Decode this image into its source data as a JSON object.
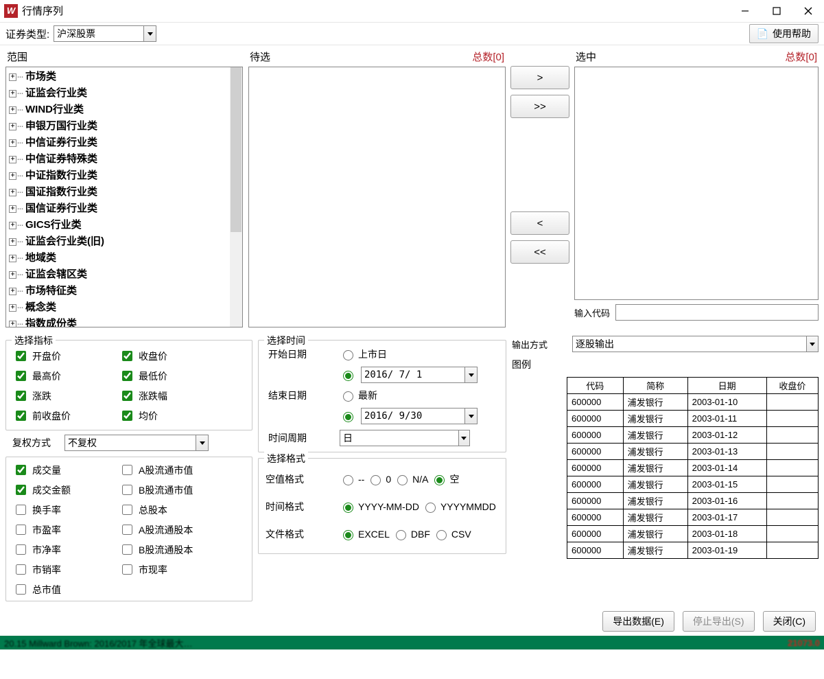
{
  "window": {
    "title": "行情序列"
  },
  "topbar": {
    "securityTypeLabel": "证券类型:",
    "securityTypeValue": "沪深股票",
    "helpLabel": "使用帮助"
  },
  "columns": {
    "rangeLabel": "范围",
    "candidateLabel": "待选",
    "candidateCount": "总数[0]",
    "selectedLabel": "选中",
    "selectedCount": "总数[0]",
    "codeLabel": "输入代码"
  },
  "tree": [
    "市场类",
    "证监会行业类",
    "WIND行业类",
    "申银万国行业类",
    "中信证券行业类",
    "中信证券特殊类",
    "中证指数行业类",
    "国证指数行业类",
    "国信证券行业类",
    "GICS行业类",
    "证监会行业类(旧)",
    "地域类",
    "证监会辖区类",
    "市场特征类",
    "概念类",
    "指数成份类"
  ],
  "move": {
    "add": ">",
    "addAll": ">>",
    "remove": "<",
    "removeAll": "<<"
  },
  "indicators": {
    "legend": "选择指标",
    "col1": [
      {
        "label": "开盘价",
        "checked": true
      },
      {
        "label": "最高价",
        "checked": true
      },
      {
        "label": "涨跌",
        "checked": true
      },
      {
        "label": "前收盘价",
        "checked": true
      }
    ],
    "col2": [
      {
        "label": "收盘价",
        "checked": true
      },
      {
        "label": "最低价",
        "checked": true
      },
      {
        "label": "涨跌幅",
        "checked": true
      },
      {
        "label": "均价",
        "checked": true
      }
    ]
  },
  "fq": {
    "label": "复权方式",
    "value": "不复权"
  },
  "extra": {
    "col1": [
      {
        "label": "成交量",
        "checked": true
      },
      {
        "label": "成交金额",
        "checked": true
      },
      {
        "label": "换手率",
        "checked": false
      },
      {
        "label": "市盈率",
        "checked": false
      },
      {
        "label": "市净率",
        "checked": false
      },
      {
        "label": "市销率",
        "checked": false
      },
      {
        "label": "总市值",
        "checked": false
      }
    ],
    "col2": [
      {
        "label": "A股流通市值",
        "checked": false
      },
      {
        "label": "B股流通市值",
        "checked": false
      },
      {
        "label": "总股本",
        "checked": false
      },
      {
        "label": "A股流通股本",
        "checked": false
      },
      {
        "label": "B股流通股本",
        "checked": false
      },
      {
        "label": "市现率",
        "checked": false
      }
    ]
  },
  "time": {
    "legend": "选择时间",
    "startLabel": "开始日期",
    "startOpt": "上市日",
    "startDate": "2016/ 7/ 1",
    "endLabel": "结束日期",
    "endOpt": "最新",
    "endDate": "2016/ 9/30",
    "periodLabel": "时间周期",
    "periodValue": "日"
  },
  "fmt": {
    "legend": "选择格式",
    "nullLabel": "空值格式",
    "nullOpts": [
      "--",
      "0",
      "N/A",
      "空"
    ],
    "nullChecked": 3,
    "timeLabel": "时间格式",
    "timeOpts": [
      "YYYY-MM-DD",
      "YYYYMMDD"
    ],
    "timeChecked": 0,
    "fileLabel": "文件格式",
    "fileOpts": [
      "EXCEL",
      "DBF",
      "CSV"
    ],
    "fileChecked": 0
  },
  "output": {
    "modeLabel": "输出方式",
    "modeValue": "逐股输出",
    "legendLabel": "图例",
    "headers": [
      "代码",
      "简称",
      "日期",
      "收盘价"
    ],
    "rows": [
      [
        "600000",
        "浦发银行",
        "2003-01-10",
        ""
      ],
      [
        "600000",
        "浦发银行",
        "2003-01-11",
        ""
      ],
      [
        "600000",
        "浦发银行",
        "2003-01-12",
        ""
      ],
      [
        "600000",
        "浦发银行",
        "2003-01-13",
        ""
      ],
      [
        "600000",
        "浦发银行",
        "2003-01-14",
        ""
      ],
      [
        "600000",
        "浦发银行",
        "2003-01-15",
        ""
      ],
      [
        "600000",
        "浦发银行",
        "2003-01-16",
        ""
      ],
      [
        "600000",
        "浦发银行",
        "2003-01-17",
        ""
      ],
      [
        "600000",
        "浦发银行",
        "2003-01-18",
        ""
      ],
      [
        "600000",
        "浦发银行",
        "2003-01-19",
        ""
      ]
    ]
  },
  "footer": {
    "export": "导出数据(E)",
    "stop": "停止导出(S)",
    "close": "关闭(C)"
  },
  "strip": {
    "left": "20.15 Millward Brown: 2016/2017 年全球最大…",
    "right": "21073.0"
  }
}
